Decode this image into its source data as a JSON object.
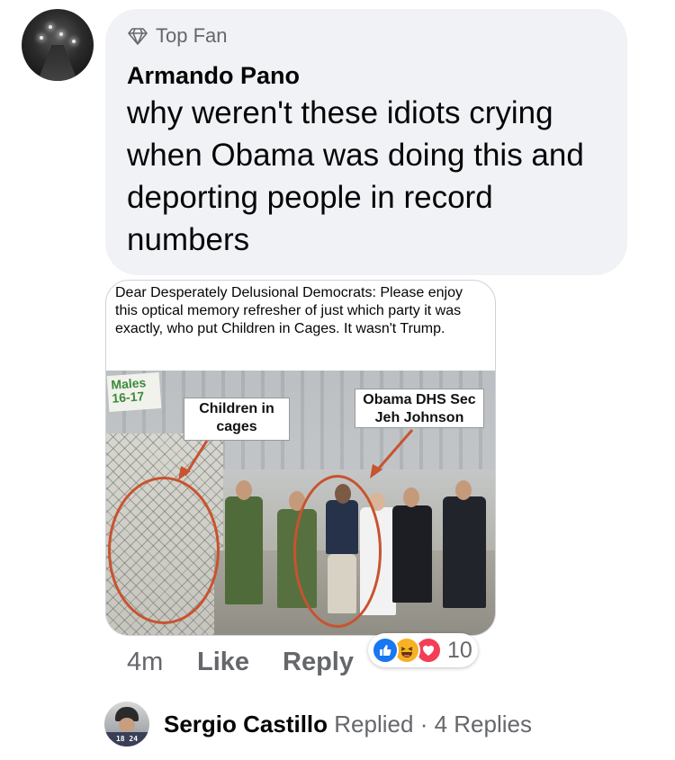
{
  "comment": {
    "badge_label": "Top Fan",
    "badge_icon": "diamond-icon",
    "author": "Armando Pano",
    "text": "why weren't these idiots crying when Obama was doing this and deporting people in record numbers"
  },
  "attachment": {
    "caption": "Dear Desperately Delusional Democrats: Please enjoy this optical memory refresher of just which party it was exactly, who put Children in Cages. It wasn't Trump.",
    "sign_text": "Males 16-17",
    "label_children": "Children in cages",
    "label_obama": "Obama DHS Sec Jeh Johnson",
    "annotation_color": "#c8532f"
  },
  "actions": {
    "time": "4m",
    "like_label": "Like",
    "reply_label": "Reply"
  },
  "reactions": {
    "icons": [
      "like-icon",
      "haha-icon",
      "love-icon"
    ],
    "count": "10",
    "colors": {
      "like": "#1877f2",
      "haha": "#f7b125",
      "love": "#f33e58"
    }
  },
  "replies": {
    "author": "Sergio Castillo",
    "action": "Replied",
    "separator": "·",
    "count_label": "4 Replies",
    "avatar_jersey": "18 24"
  }
}
